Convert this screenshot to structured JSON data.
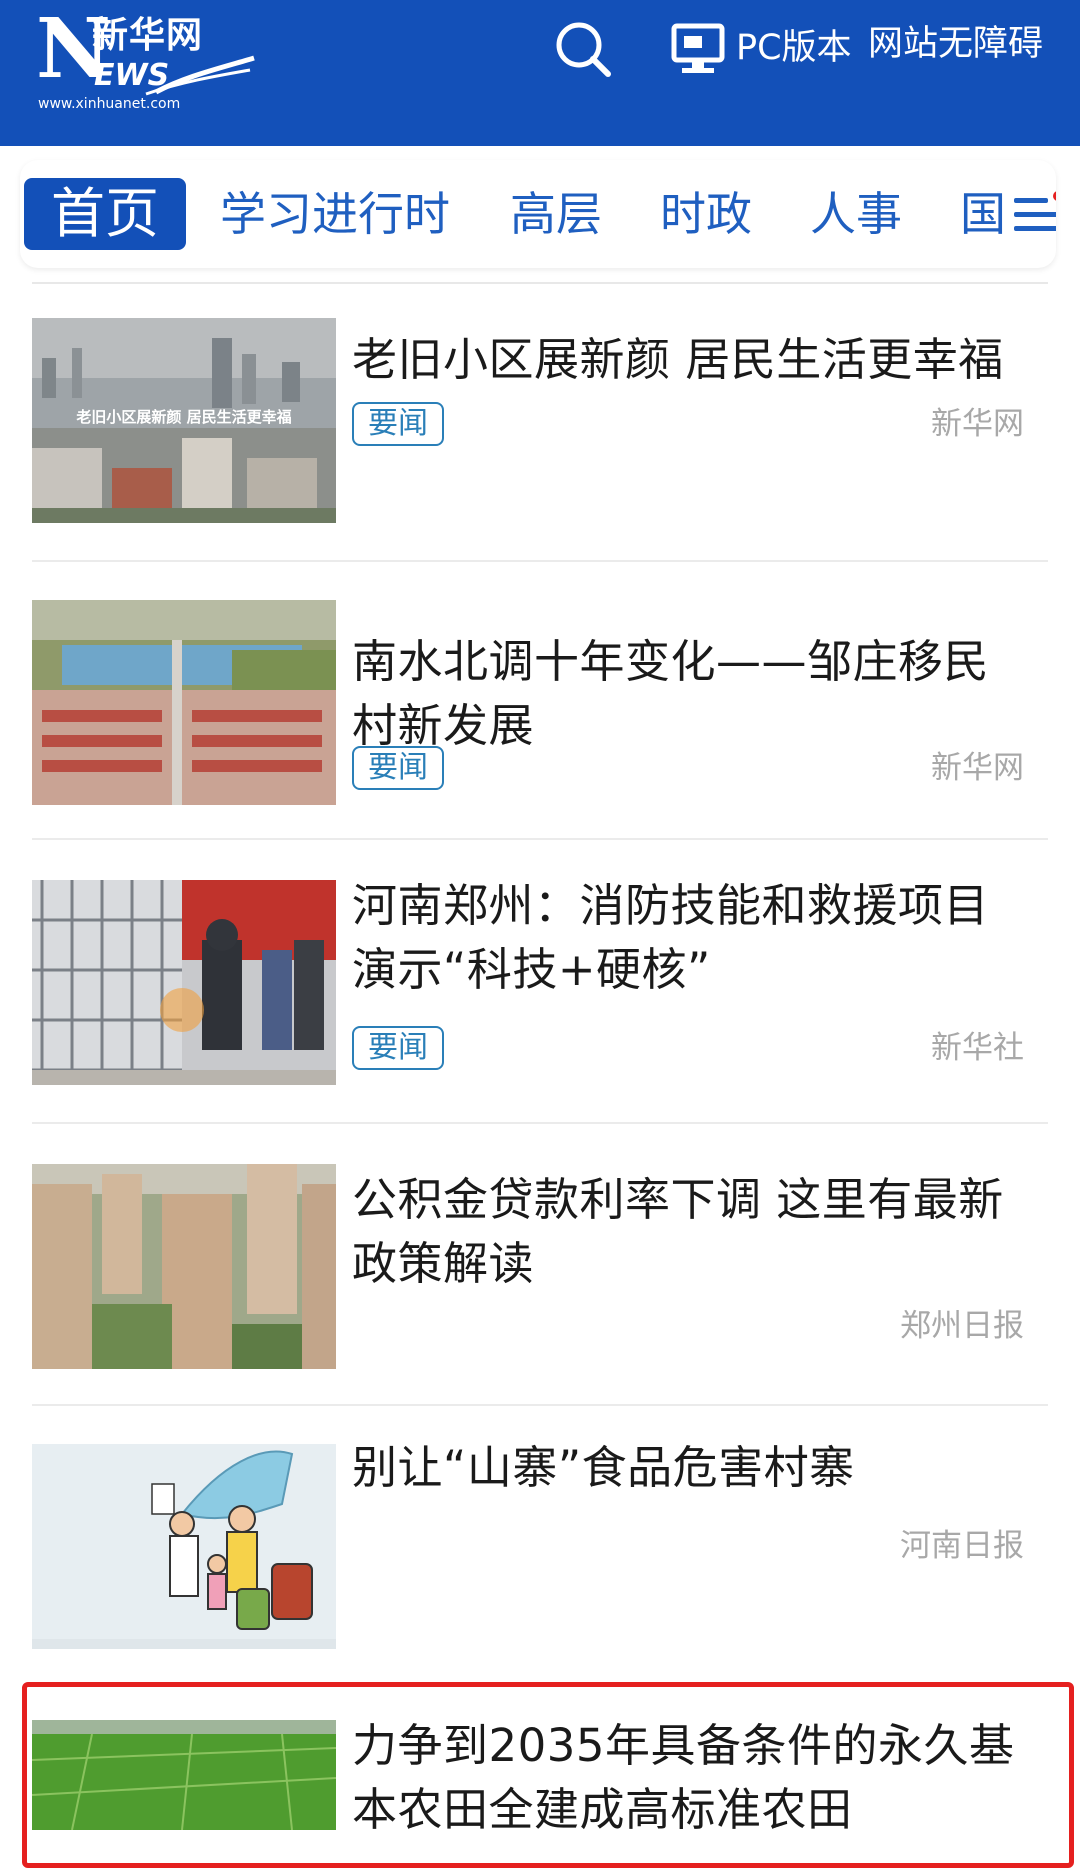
{
  "header": {
    "logo": {
      "cn": "新华网",
      "en": "NEWS",
      "url": "www.xinhuanet.com"
    },
    "search_icon": "search-icon",
    "pc_label": "PC版本",
    "accessibility_label": "网站无障碍",
    "bg_color": "#1350b8"
  },
  "nav": {
    "tabs": [
      "首页",
      "学习进行时",
      "高层",
      "时政",
      "人事",
      "国"
    ],
    "active_index": 0,
    "menu_icon": "menu-icon"
  },
  "news": [
    {
      "title_lines": [
        "老旧小区展新颜 居民生活更幸福"
      ],
      "tag": "要闻",
      "source": "新华网",
      "thumb_caption": "老旧小区展新颜 居民生活更幸福"
    },
    {
      "title_lines": [
        "南水北调十年变化——邹庄移民",
        "村新发展"
      ],
      "tag": "要闻",
      "source": "新华网"
    },
    {
      "title_lines": [
        "河南郑州：消防技能和救援项目",
        "演示“科技+硬核”"
      ],
      "tag": "要闻",
      "source": "新华社"
    },
    {
      "title_lines": [
        "公积金贷款利率下调 这里有最新",
        "政策解读"
      ],
      "tag": "",
      "source": "郑州日报"
    },
    {
      "title_lines": [
        "别让“山寨”食品危害村寨"
      ],
      "tag": "",
      "source": "河南日报"
    },
    {
      "title_lines": [
        "力争到2035年具备条件的永久基",
        "本农田全建成高标准农田"
      ],
      "tag": "",
      "source": ""
    }
  ],
  "colors": {
    "accent": "#1350b8",
    "tag": "#2a7fb8",
    "highlight": "#e5201f"
  }
}
